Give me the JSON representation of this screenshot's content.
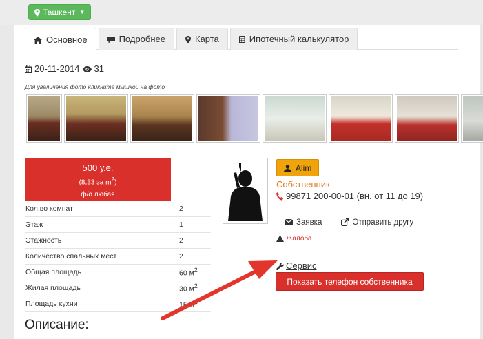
{
  "topbar": {
    "city": "Ташкент"
  },
  "tabs": [
    {
      "label": "Основное",
      "icon": "home-icon"
    },
    {
      "label": "Подробнее",
      "icon": "comment-icon"
    },
    {
      "label": "Карта",
      "icon": "map-marker-icon"
    },
    {
      "label": "Ипотечный калькулятор",
      "icon": "calculator-icon"
    }
  ],
  "listing": {
    "date": "20-11-2014",
    "views": "31",
    "photo_hint": "Для увеличения фото кликните мышкой на фото"
  },
  "price": {
    "main": "500 у.е.",
    "per_m2": "(8,33 за m",
    "per_m2_sup": "2",
    "per_m2_close": ")",
    "payment": "ф/о любая"
  },
  "specs": [
    {
      "label": "Кол.во комнат",
      "value": "2"
    },
    {
      "label": "Этаж",
      "value": "1"
    },
    {
      "label": "Этажность",
      "value": "2"
    },
    {
      "label": "Количество спальных мест",
      "value": "2"
    },
    {
      "label": "Общая площадь",
      "value": "60 м",
      "sup": "2"
    },
    {
      "label": "Жилая площадь",
      "value": "30 м",
      "sup": "2"
    },
    {
      "label": "Площадь кухни",
      "value": "15 м",
      "sup": "2"
    }
  ],
  "description_title": "Описание:",
  "owner": {
    "name": "Alim",
    "role": "Собственник",
    "phone": "99871 200-00-01 (вн. от 11 до 19)"
  },
  "actions": {
    "request": "Заявка",
    "send_friend": "Отправить другу",
    "complaint": "Жалоба",
    "service": "Сервис",
    "show_phone": "Показать телефон собственника"
  },
  "colors": {
    "accent_red": "#d9302c",
    "green": "#5cb85c",
    "orange": "#f0a30a",
    "owner_role": "#e07a1f"
  }
}
